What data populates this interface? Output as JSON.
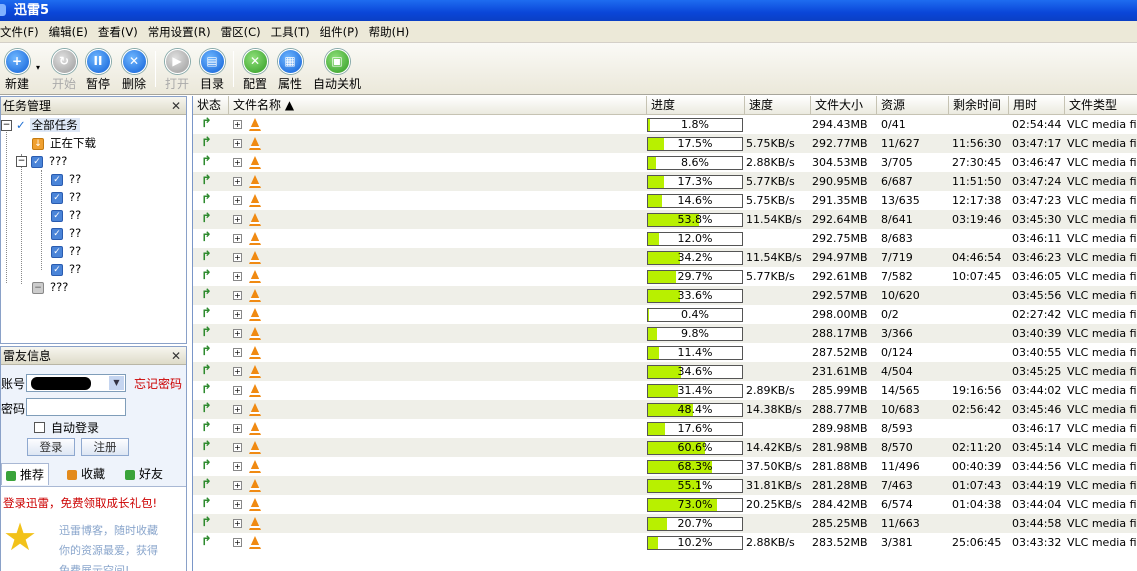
{
  "app": {
    "title": "迅雷5"
  },
  "menu": [
    "文件(F)",
    "编辑(E)",
    "查看(V)",
    "常用设置(R)",
    "雷区(C)",
    "工具(T)",
    "组件(P)",
    "帮助(H)"
  ],
  "toolbar": {
    "new": "新建",
    "start": "开始",
    "pause": "暂停",
    "delete": "删除",
    "open": "打开",
    "dir": "目录",
    "config": "配置",
    "props": "属性",
    "shutdown": "自动关机"
  },
  "task_panel": {
    "title": "任务管理",
    "close": "✕",
    "all": "全部任务",
    "downloading": "正在下载",
    "group1": "???",
    "subs": [
      "??",
      "??",
      "??",
      "??",
      "??",
      "??"
    ],
    "group2": "???"
  },
  "friend_panel": {
    "title": "雷友信息",
    "close": "✕",
    "account_label": "账号",
    "forgot": "忘记密码",
    "password_label": "密码",
    "auto_login": "自动登录",
    "login": "登录",
    "register": "注册",
    "tabs": [
      "推荐",
      "收藏",
      "好友"
    ],
    "promo": "登录迅雷，免费领取成长礼包!",
    "blog_lines": [
      "迅雷博客，随时收藏",
      "你的资源最爱，获得",
      "免费展示空间!"
    ]
  },
  "columns": [
    "状态",
    "文件名称 ▲",
    "进度",
    "速度",
    "文件大小",
    "资源",
    "剩余时间",
    "用时",
    "文件类型"
  ],
  "rows": [
    {
      "progress": "1.8%",
      "pct": 1.8,
      "speed": "",
      "size": "294.43MB",
      "res": "0/41",
      "remain": "",
      "used": "02:54:44",
      "type": "VLC media file"
    },
    {
      "progress": "17.5%",
      "pct": 17.5,
      "speed": "5.75KB/s",
      "size": "292.77MB",
      "res": "11/627",
      "remain": "11:56:30",
      "used": "03:47:17",
      "type": "VLC media file"
    },
    {
      "progress": "8.6%",
      "pct": 8.6,
      "speed": "2.88KB/s",
      "size": "304.53MB",
      "res": "3/705",
      "remain": "27:30:45",
      "used": "03:46:47",
      "type": "VLC media file"
    },
    {
      "progress": "17.3%",
      "pct": 17.3,
      "speed": "5.77KB/s",
      "size": "290.95MB",
      "res": "6/687",
      "remain": "11:51:50",
      "used": "03:47:24",
      "type": "VLC media file"
    },
    {
      "progress": "14.6%",
      "pct": 14.6,
      "speed": "5.75KB/s",
      "size": "291.35MB",
      "res": "13/635",
      "remain": "12:17:38",
      "used": "03:47:23",
      "type": "VLC media file"
    },
    {
      "progress": "53.8%",
      "pct": 53.8,
      "speed": "11.54KB/s",
      "size": "292.64MB",
      "res": "8/641",
      "remain": "03:19:46",
      "used": "03:45:30",
      "type": "VLC media file"
    },
    {
      "progress": "12.0%",
      "pct": 12.0,
      "speed": "",
      "size": "292.75MB",
      "res": "8/683",
      "remain": "",
      "used": "03:46:11",
      "type": "VLC media file"
    },
    {
      "progress": "34.2%",
      "pct": 34.2,
      "speed": "11.54KB/s",
      "size": "294.97MB",
      "res": "7/719",
      "remain": "04:46:54",
      "used": "03:46:23",
      "type": "VLC media file"
    },
    {
      "progress": "29.7%",
      "pct": 29.7,
      "speed": "5.77KB/s",
      "size": "292.61MB",
      "res": "7/582",
      "remain": "10:07:45",
      "used": "03:46:05",
      "type": "VLC media file"
    },
    {
      "progress": "33.6%",
      "pct": 33.6,
      "speed": "",
      "size": "292.57MB",
      "res": "10/620",
      "remain": "",
      "used": "03:45:56",
      "type": "VLC media file"
    },
    {
      "progress": "0.4%",
      "pct": 0.4,
      "speed": "",
      "size": "298.00MB",
      "res": "0/2",
      "remain": "",
      "used": "02:27:42",
      "type": "VLC media file"
    },
    {
      "progress": "9.8%",
      "pct": 9.8,
      "speed": "",
      "size": "288.17MB",
      "res": "3/366",
      "remain": "",
      "used": "03:40:39",
      "type": "VLC media file"
    },
    {
      "progress": "11.4%",
      "pct": 11.4,
      "speed": "",
      "size": "287.52MB",
      "res": "0/124",
      "remain": "",
      "used": "03:40:55",
      "type": "VLC media file"
    },
    {
      "progress": "34.6%",
      "pct": 34.6,
      "speed": "",
      "size": "231.61MB",
      "res": "4/504",
      "remain": "",
      "used": "03:45:25",
      "type": "VLC media file"
    },
    {
      "progress": "31.4%",
      "pct": 31.4,
      "speed": "2.89KB/s",
      "size": "285.99MB",
      "res": "14/565",
      "remain": "19:16:56",
      "used": "03:44:02",
      "type": "VLC media file"
    },
    {
      "progress": "48.4%",
      "pct": 48.4,
      "speed": "14.38KB/s",
      "size": "288.77MB",
      "res": "10/683",
      "remain": "02:56:42",
      "used": "03:45:46",
      "type": "VLC media file"
    },
    {
      "progress": "17.6%",
      "pct": 17.6,
      "speed": "",
      "size": "289.98MB",
      "res": "8/593",
      "remain": "",
      "used": "03:46:17",
      "type": "VLC media file"
    },
    {
      "progress": "60.6%",
      "pct": 60.6,
      "speed": "14.42KB/s",
      "size": "281.98MB",
      "res": "8/570",
      "remain": "02:11:20",
      "used": "03:45:14",
      "type": "VLC media file"
    },
    {
      "progress": "68.3%",
      "pct": 68.3,
      "speed": "37.50KB/s",
      "size": "281.88MB",
      "res": "11/496",
      "remain": "00:40:39",
      "used": "03:44:56",
      "type": "VLC media file"
    },
    {
      "progress": "55.1%",
      "pct": 55.1,
      "speed": "31.81KB/s",
      "size": "281.28MB",
      "res": "7/463",
      "remain": "01:07:43",
      "used": "03:44:19",
      "type": "VLC media file"
    },
    {
      "progress": "73.0%",
      "pct": 73.0,
      "speed": "20.25KB/s",
      "size": "284.42MB",
      "res": "6/574",
      "remain": "01:04:38",
      "used": "03:44:04",
      "type": "VLC media file"
    },
    {
      "progress": "20.7%",
      "pct": 20.7,
      "speed": "",
      "size": "285.25MB",
      "res": "11/663",
      "remain": "",
      "used": "03:44:58",
      "type": "VLC media file"
    },
    {
      "progress": "10.2%",
      "pct": 10.2,
      "speed": "2.88KB/s",
      "size": "283.52MB",
      "res": "3/381",
      "remain": "25:06:45",
      "used": "03:43:32",
      "type": "VLC media file"
    }
  ]
}
